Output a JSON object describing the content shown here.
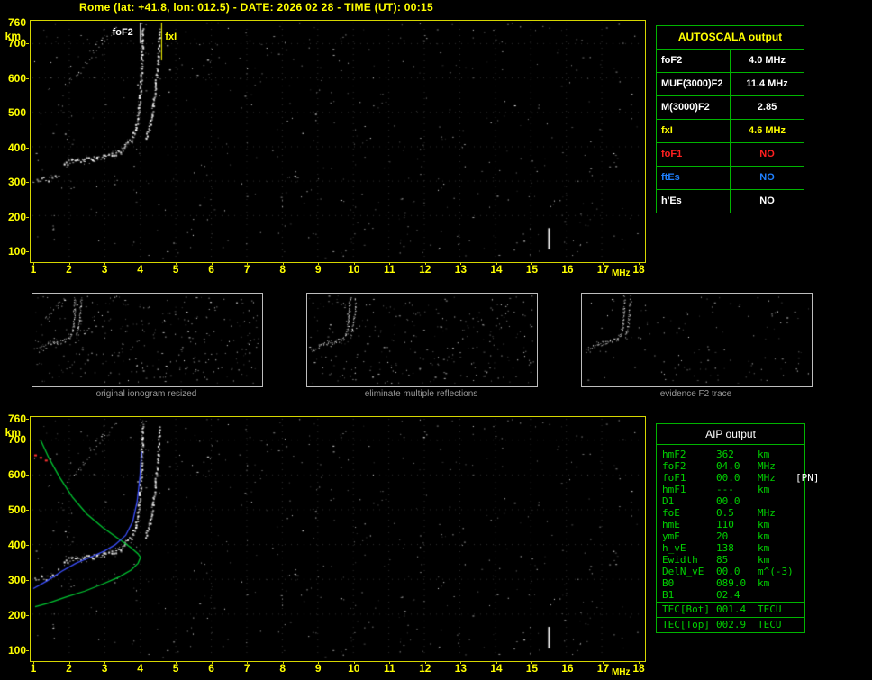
{
  "header": {
    "title": "Rome (lat: +41.8, lon: 012.5) - DATE: 2026 02 28 - TIME (UT): 00:15"
  },
  "ionogram": {
    "x_axis": {
      "label": "MHz",
      "ticks": [
        1,
        2,
        3,
        4,
        5,
        6,
        7,
        8,
        9,
        10,
        11,
        12,
        13,
        14,
        15,
        16,
        17,
        18
      ]
    },
    "y_axis": {
      "label": "km",
      "ticks": [
        760,
        700,
        600,
        500,
        400,
        300,
        200,
        100
      ]
    },
    "foF2_label": "foF2",
    "fxI_label": "fxI",
    "foF2_mhz": 4.0,
    "fxI_mhz": 4.6
  },
  "autoscala": {
    "title": "AUTOSCALA output",
    "rows": [
      {
        "label": "foF2",
        "value": "4.0 MHz",
        "color": "#FFFFFF"
      },
      {
        "label": "MUF(3000)F2",
        "value": "11.4 MHz",
        "color": "#FFFFFF"
      },
      {
        "label": "M(3000)F2",
        "value": "2.85",
        "color": "#FFFFFF"
      },
      {
        "label": "fxI",
        "value": "4.6 MHz",
        "color": "#FFFF00"
      },
      {
        "label": "foF1",
        "value": "NO",
        "color": "#FF2020"
      },
      {
        "label": "ftEs",
        "value": "NO",
        "color": "#2080FF"
      },
      {
        "label": "h'Es",
        "value": "NO",
        "color": "#FFFFFF"
      }
    ]
  },
  "thumbnails": [
    {
      "caption": "original ionogram resized"
    },
    {
      "caption": "eliminate multiple reflections"
    },
    {
      "caption": "evidence F2 trace"
    }
  ],
  "aip": {
    "title": "AIP output",
    "rows": [
      {
        "label": "hmF2",
        "value": "362",
        "unit": "km"
      },
      {
        "label": "foF2",
        "value": "04.0",
        "unit": "MHz"
      },
      {
        "label": "foF1",
        "value": "00.0",
        "unit": "MHz",
        "extra": "[PN]"
      },
      {
        "label": "hmF1",
        "value": "---",
        "unit": "km"
      },
      {
        "label": "D1",
        "value": "00.0",
        "unit": ""
      },
      {
        "label": "foE",
        "value": "0.5",
        "unit": "MHz"
      },
      {
        "label": "hmE",
        "value": "110",
        "unit": "km"
      },
      {
        "label": "ymE",
        "value": "20",
        "unit": "km"
      },
      {
        "label": "h_vE",
        "value": "138",
        "unit": "km"
      },
      {
        "label": "Ewidth",
        "value": "85",
        "unit": "km"
      },
      {
        "label": "DelN_vE",
        "value": "00.0",
        "unit": "m^(-3)"
      },
      {
        "label": "B0",
        "value": "089.0",
        "unit": "km"
      },
      {
        "label": "B1",
        "value": "02.4",
        "unit": ""
      },
      {
        "label": "TEC[Bot]",
        "value": "001.4",
        "unit": "TECU",
        "sep": true
      },
      {
        "label": "TEC[Top]",
        "value": "002.9",
        "unit": "TECU",
        "sep": true
      }
    ]
  },
  "chart_data": {
    "type": "scatter",
    "title": "vertical incidence ionogram",
    "x_label": "MHz",
    "y_label": "km",
    "x_range": [
      1,
      18
    ],
    "y_range": [
      100,
      760
    ],
    "foF2_mhz": 4.0,
    "fxI_mhz": 4.6,
    "f2_trace": [
      [
        1.85,
        352
      ],
      [
        2.1,
        358
      ],
      [
        2.4,
        362
      ],
      [
        2.7,
        366
      ],
      [
        3.0,
        372
      ],
      [
        3.3,
        382
      ],
      [
        3.55,
        398
      ],
      [
        3.75,
        422
      ],
      [
        3.88,
        455
      ],
      [
        3.95,
        500
      ],
      [
        4.0,
        560
      ],
      [
        4.04,
        635
      ],
      [
        4.07,
        745
      ]
    ],
    "x_trace": [
      [
        4.15,
        420
      ],
      [
        4.25,
        455
      ],
      [
        4.33,
        500
      ],
      [
        4.42,
        570
      ],
      [
        4.5,
        655
      ],
      [
        4.55,
        740
      ]
    ],
    "low_trace": [
      [
        1.0,
        300
      ],
      [
        1.25,
        305
      ],
      [
        1.5,
        312
      ],
      [
        1.7,
        322
      ]
    ],
    "second_hop": [
      [
        1.9,
        575
      ],
      [
        2.3,
        620
      ],
      [
        2.7,
        672
      ],
      [
        3.1,
        718
      ],
      [
        3.3,
        745
      ]
    ],
    "interference_mhz": 15.5,
    "interference_km": [
      100,
      162
    ],
    "profile_green": [
      [
        1.2,
        700
      ],
      [
        1.45,
        645
      ],
      [
        1.75,
        590
      ],
      [
        2.1,
        535
      ],
      [
        2.5,
        487
      ],
      [
        2.95,
        448
      ],
      [
        3.4,
        415
      ],
      [
        3.75,
        390
      ],
      [
        3.95,
        372
      ],
      [
        4.02,
        362
      ],
      [
        3.95,
        345
      ],
      [
        3.75,
        325
      ],
      [
        3.4,
        305
      ],
      [
        2.95,
        285
      ],
      [
        2.45,
        265
      ],
      [
        1.9,
        247
      ],
      [
        1.4,
        230
      ],
      [
        1.05,
        220
      ]
    ],
    "blue_trace": [
      [
        1.0,
        272
      ],
      [
        1.4,
        295
      ],
      [
        1.8,
        322
      ],
      [
        2.2,
        345
      ],
      [
        2.6,
        362
      ],
      [
        3.0,
        380
      ],
      [
        3.3,
        398
      ],
      [
        3.6,
        425
      ],
      [
        3.8,
        465
      ],
      [
        3.92,
        520
      ],
      [
        4.0,
        590
      ],
      [
        4.05,
        665
      ]
    ],
    "red_marks": [
      [
        1.05,
        655
      ],
      [
        1.2,
        648
      ],
      [
        1.35,
        640
      ]
    ]
  }
}
